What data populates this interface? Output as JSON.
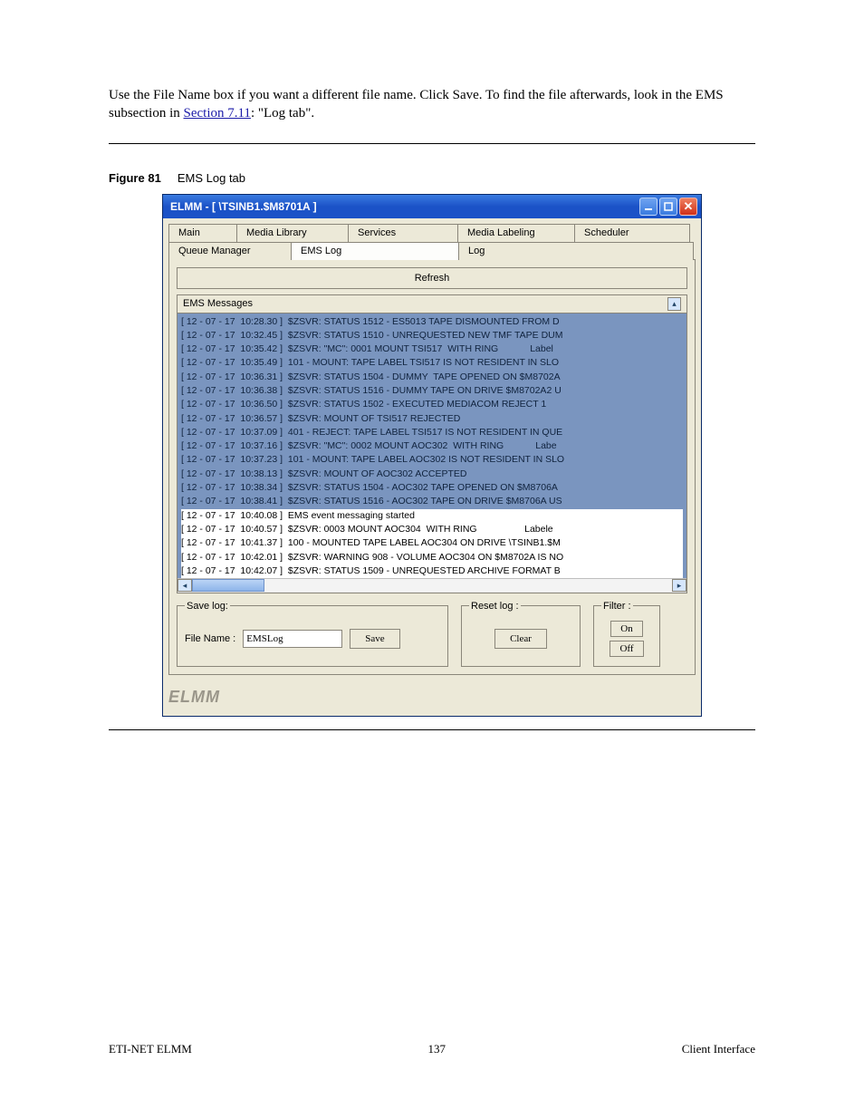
{
  "doc": {
    "intro_prefix": "Use the File Name box if you want a different file name. Click Save. To find the file afterwards, look in the EMS subsection in ",
    "intro_link_text": "Section 7.11",
    "intro_suffix": ": \"Log tab\".",
    "fig_num": "Figure 81",
    "fig_title": "EMS Log tab",
    "footer_left": "ETI-NET ELMM",
    "footer_center": "137",
    "footer_right": "Client Interface"
  },
  "window": {
    "title": "ELMM - [ \\TSINB1.$M8701A ]",
    "brand": "ELMM",
    "tabs_row1": [
      "Main",
      "Media Library",
      "Services",
      "Media Labeling",
      "Scheduler"
    ],
    "tabs_row2": [
      "Queue Manager",
      "EMS Log",
      "Log"
    ],
    "active_tab": "EMS Log",
    "refresh": "Refresh",
    "list_header": "EMS Messages",
    "log_lines": [
      "[ 12 - 07 - 17  10:28.30 ]  $ZSVR: STATUS 1512 - ES5013 TAPE DISMOUNTED FROM D",
      "[ 12 - 07 - 17  10:32.45 ]  $ZSVR: STATUS 1510 - UNREQUESTED NEW TMF TAPE DUM",
      "[ 12 - 07 - 17  10:35.42 ]  $ZSVR: \"MC\": 0001 MOUNT TSI517  WITH RING            Label",
      "[ 12 - 07 - 17  10:35.49 ]  101 - MOUNT: TAPE LABEL TSI517 IS NOT RESIDENT IN SLO",
      "[ 12 - 07 - 17  10:36.31 ]  $ZSVR: STATUS 1504 - DUMMY  TAPE OPENED ON $M8702A",
      "[ 12 - 07 - 17  10:36.38 ]  $ZSVR: STATUS 1516 - DUMMY TAPE ON DRIVE $M8702A2 U",
      "[ 12 - 07 - 17  10:36.50 ]  $ZSVR: STATUS 1502 - EXECUTED MEDIACOM REJECT 1",
      "[ 12 - 07 - 17  10:36.57 ]  $ZSVR: MOUNT OF TSI517 REJECTED",
      "[ 12 - 07 - 17  10:37.09 ]  401 - REJECT: TAPE LABEL TSI517 IS NOT RESIDENT IN QUE",
      "[ 12 - 07 - 17  10:37.16 ]  $ZSVR: \"MC\": 0002 MOUNT AOC302  WITH RING            Labe",
      "[ 12 - 07 - 17  10:37.23 ]  101 - MOUNT: TAPE LABEL AOC302 IS NOT RESIDENT IN SLO",
      "[ 12 - 07 - 17  10:38.13 ]  $ZSVR: MOUNT OF AOC302 ACCEPTED",
      "[ 12 - 07 - 17  10:38.34 ]  $ZSVR: STATUS 1504 - AOC302 TAPE OPENED ON $M8706A",
      "[ 12 - 07 - 17  10:38.41 ]  $ZSVR: STATUS 1516 - AOC302 TAPE ON DRIVE $M8706A US",
      "[ 12 - 07 - 17  10:40.08 ]  EMS event messaging started",
      "[ 12 - 07 - 17  10:40.57 ]  $ZSVR: 0003 MOUNT AOC304  WITH RING                  Labele",
      "[ 12 - 07 - 17  10:41.37 ]  100 - MOUNTED TAPE LABEL AOC304 ON DRIVE \\TSINB1.$M",
      "[ 12 - 07 - 17  10:42.01 ]  $ZSVR: WARNING 908 - VOLUME AOC304 ON $M8702A IS NO",
      "[ 12 - 07 - 17  10:42.07 ]  $ZSVR: STATUS 1509 - UNREQUESTED ARCHIVE FORMAT B"
    ],
    "unselected_indices": [
      14,
      15,
      16,
      17,
      18
    ],
    "save": {
      "legend": "Save log:",
      "label": "File Name :",
      "value": "EMSLog",
      "button": "Save"
    },
    "reset": {
      "legend": "Reset log :",
      "button": "Clear"
    },
    "filter": {
      "legend": "Filter :",
      "on": "On",
      "off": "Off"
    }
  }
}
